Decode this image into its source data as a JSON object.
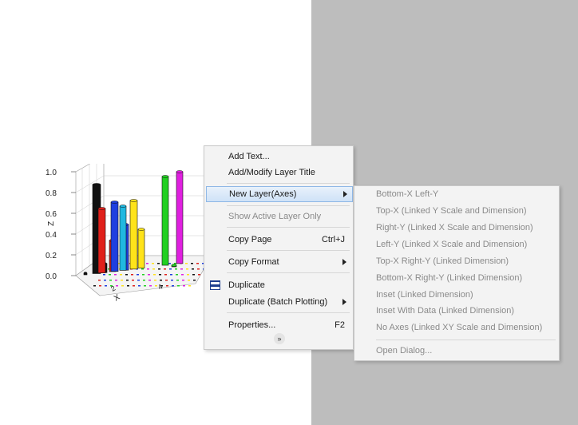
{
  "graph": {
    "z_label": "Z",
    "x_label": "X",
    "z_ticks": [
      "1.0",
      "0.8",
      "0.6",
      "0.4",
      "0.2",
      "0.0"
    ],
    "x_ticks": [
      "2",
      "4"
    ]
  },
  "context_menu": {
    "items": [
      {
        "label": "Add Text...",
        "enabled": true
      },
      {
        "label": "Add/Modify Layer Title",
        "enabled": true
      },
      {
        "label": "New Layer(Axes)",
        "enabled": true,
        "submenu": true,
        "highlighted": true
      },
      {
        "label": "Show Active Layer Only",
        "enabled": false
      },
      {
        "label": "Copy Page",
        "shortcut": "Ctrl+J",
        "enabled": true
      },
      {
        "label": "Copy Format",
        "enabled": true,
        "submenu": true
      },
      {
        "label": "Duplicate",
        "enabled": true,
        "icon": "duplicate-icon"
      },
      {
        "label": "Duplicate (Batch Plotting)",
        "enabled": true,
        "submenu": true
      },
      {
        "label": "Properties...",
        "shortcut": "F2",
        "enabled": true
      }
    ],
    "more_icon": "chevron-double-down-icon"
  },
  "submenu": {
    "items": [
      "Bottom-X Left-Y",
      "Top-X (Linked Y Scale and Dimension)",
      "Right-Y (Linked X Scale and Dimension)",
      "Left-Y (Linked X Scale and Dimension)",
      "Top-X Right-Y (Linked Dimension)",
      "Bottom-X Right-Y (Linked Dimension)",
      "Inset (Linked Dimension)",
      "Inset With Data (Linked Dimension)",
      "No Axes (Linked XY Scale and Dimension)",
      "Open Dialog..."
    ]
  },
  "colors": {
    "highlight": "#cfe2f7",
    "disabled_text": "#8a8a8a",
    "right_panel": "#bdbdbd"
  }
}
